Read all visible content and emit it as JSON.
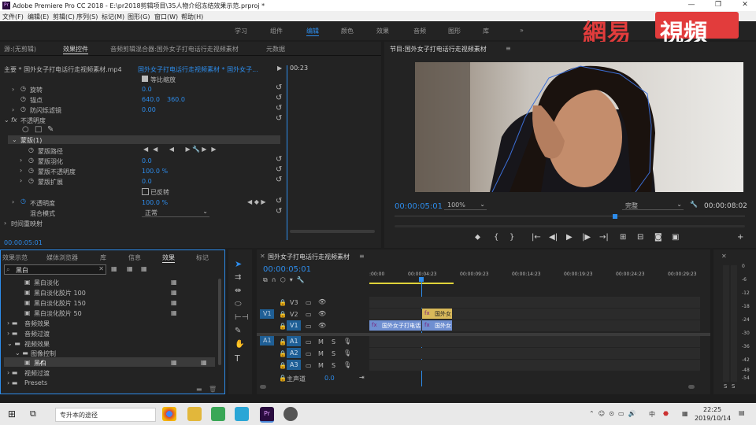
{
  "window": {
    "title": "Adobe Premiere Pro CC 2018 - E:\\pr2018剪辑项目\\35人物介绍冻结效果示范.prproj *"
  },
  "menu": [
    "文件(F)",
    "编辑(E)",
    "剪辑(C)",
    "序列(S)",
    "标记(M)",
    "图形(G)",
    "窗口(W)",
    "帮助(H)"
  ],
  "workspaces": [
    "学习",
    "组件",
    "编辑",
    "颜色",
    "效果",
    "音频",
    "图形",
    "库",
    "»"
  ],
  "watermark": "網易視頻",
  "effect_controls": {
    "tabs": [
      "源:(无剪辑)",
      "效果控件",
      "音频剪辑混合器:国外女子打电话行走视频素材",
      "元数据"
    ],
    "header_left": "主要 * 国外女子打电话行走视频素材.mp4",
    "header_right": "国外女子打电话行走视频素材 * 国外女子...",
    "ruler_time": "00:23",
    "uniform_scale": "等比缩放",
    "rotation": {
      "label": "旋转",
      "value": "0.0"
    },
    "anchor": {
      "label": "锚点",
      "x": "640.0",
      "y": "360.0"
    },
    "flicker": {
      "label": "防闪烁滤镜",
      "value": "0.00"
    },
    "opacity_group": "不透明度",
    "mask": "蒙版(1)",
    "mask_path": "蒙版路径",
    "mask_feather": {
      "label": "蒙版羽化",
      "value": "0.0"
    },
    "mask_opacity": {
      "label": "蒙版不透明度",
      "value": "100.0 %"
    },
    "mask_expansion": {
      "label": "蒙版扩展",
      "value": "0.0"
    },
    "inverted": "已反转",
    "opacity": {
      "label": "不透明度",
      "value": "100.0 %"
    },
    "blend_mode": {
      "label": "混合模式",
      "value": "正常"
    },
    "time_remap": "时间重映射",
    "timecode": "00:00:05:01"
  },
  "program": {
    "title": "节目:国外女子打电话行走视频素材",
    "timecode": "00:00:05:01",
    "zoom": "100%",
    "quality": "完整",
    "duration": "00:00:08:02"
  },
  "effects_panel": {
    "tabs": [
      "效果示范",
      "媒体浏览器",
      "库",
      "信息",
      "效果",
      "标记"
    ],
    "search": "黑白",
    "items": [
      "黑白淡化",
      "黑白淡化胶片 100",
      "黑白淡化胶片 150",
      "黑白淡化胶片 50"
    ],
    "folders": [
      "音频效果",
      "音频过渡",
      "视频效果",
      "图像控制",
      "黑白",
      "视频过渡",
      "Presets"
    ]
  },
  "timeline": {
    "title": "国外女子打电话行走视频素材",
    "timecode": "00:00:05:01",
    "ruler": [
      ":00:00",
      "00:00:04:23",
      "00:00:09:23",
      "00:00:14:23",
      "00:00:19:23",
      "00:00:24:23",
      "00:00:29:23"
    ],
    "tracks_video": [
      "V3",
      "V2",
      "V1"
    ],
    "tracks_audio": [
      "A1",
      "A2",
      "A3"
    ],
    "source_patch": [
      "V1",
      "A1"
    ],
    "master": {
      "label": "主声道",
      "value": "0.0"
    },
    "clips": {
      "v2": "国外女",
      "v1a": "国外女子打电话",
      "v1b": "国外女"
    }
  },
  "meter": {
    "scale": [
      "0",
      "-6",
      "-12",
      "-18",
      "-24",
      "-30",
      "-36",
      "-42",
      "-48",
      "-54"
    ],
    "footer": [
      "S",
      "S"
    ]
  },
  "taskbar": {
    "search": "专升本的途径",
    "time": "22:25",
    "date": "2019/10/14",
    "lang": "中"
  }
}
